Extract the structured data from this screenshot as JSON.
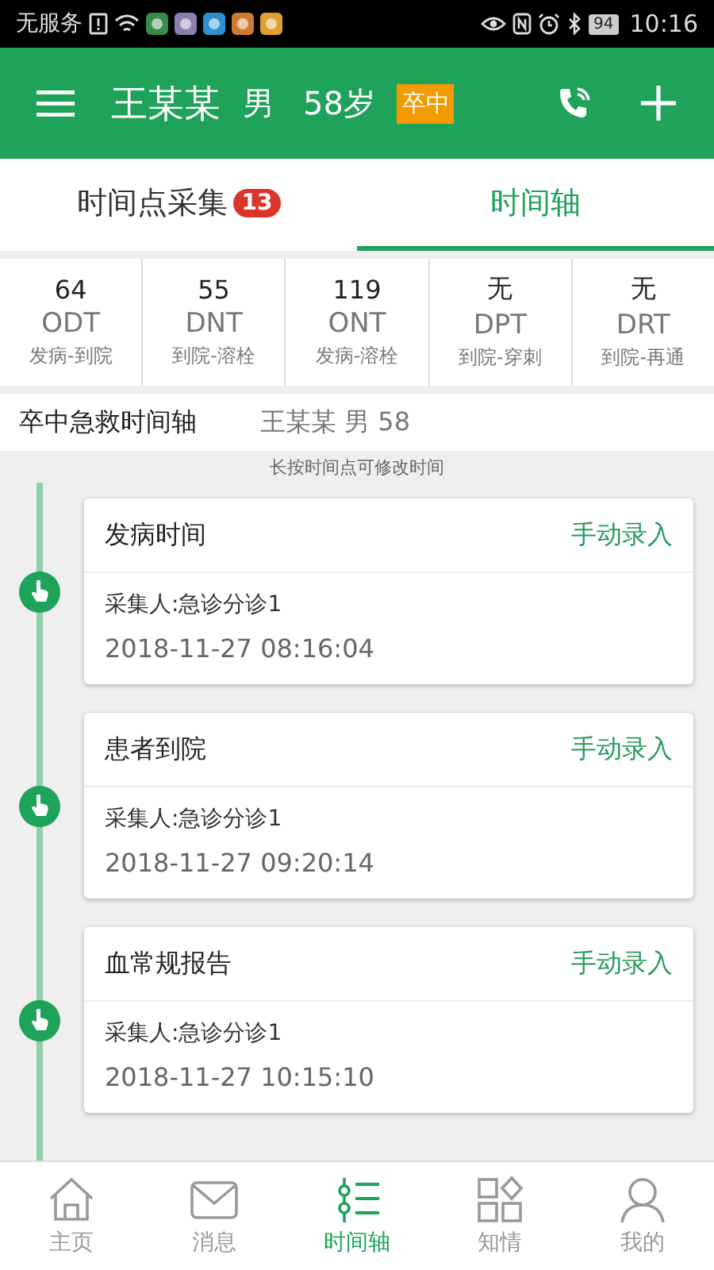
{
  "status_bar": {
    "carrier": "无服务",
    "battery": "94",
    "time": "10:16"
  },
  "header": {
    "name": "王某某",
    "sex": "男",
    "age": "58岁",
    "tag": "卒中"
  },
  "tabs": [
    {
      "label": "时间点采集",
      "badge": "13",
      "selected": false
    },
    {
      "label": "时间轴",
      "selected": true
    }
  ],
  "metrics": [
    {
      "value": "64",
      "code": "ODT",
      "desc": "发病-到院"
    },
    {
      "value": "55",
      "code": "DNT",
      "desc": "到院-溶栓"
    },
    {
      "value": "119",
      "code": "ONT",
      "desc": "发病-溶栓"
    },
    {
      "value": "无",
      "code": "DPT",
      "desc": "到院-穿刺"
    },
    {
      "value": "无",
      "code": "DRT",
      "desc": "到院-再通"
    }
  ],
  "section": {
    "title": "卒中急救时间轴",
    "patient": "王某某 男 58"
  },
  "hint": "长按时间点可修改时间",
  "events": [
    {
      "title": "发病时间",
      "action": "手动录入",
      "collector": "采集人:急诊分诊1",
      "time": "2018-11-27 08:16:04"
    },
    {
      "title": "患者到院",
      "action": "手动录入",
      "collector": "采集人:急诊分诊1",
      "time": "2018-11-27 09:20:14"
    },
    {
      "title": "血常规报告",
      "action": "手动录入",
      "collector": "采集人:急诊分诊1",
      "time": "2018-11-27 10:15:10"
    }
  ],
  "nav": [
    {
      "label": "主页",
      "selected": false
    },
    {
      "label": "消息",
      "selected": false
    },
    {
      "label": "时间轴",
      "selected": true
    },
    {
      "label": "知情",
      "selected": false
    },
    {
      "label": "我的",
      "selected": false
    }
  ]
}
